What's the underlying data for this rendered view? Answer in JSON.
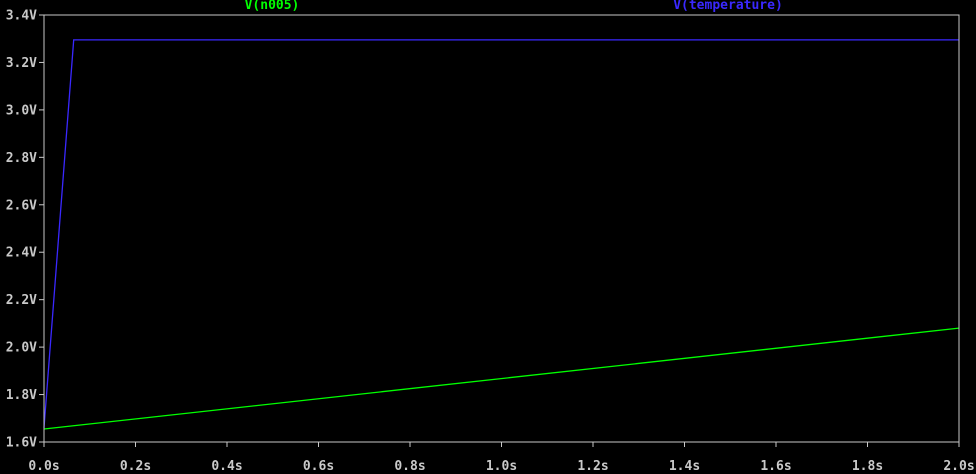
{
  "chart_data": {
    "type": "line",
    "title": "",
    "xlabel": "",
    "ylabel": "",
    "xlim": [
      0.0,
      2.0
    ],
    "ylim": [
      1.6,
      3.4
    ],
    "grid": false,
    "x_ticks": [
      0.0,
      0.2,
      0.4,
      0.6,
      0.8,
      1.0,
      1.2,
      1.4,
      1.6,
      1.8,
      2.0
    ],
    "x_tick_labels": [
      "0.0s",
      "0.2s",
      "0.4s",
      "0.6s",
      "0.8s",
      "1.0s",
      "1.2s",
      "1.4s",
      "1.6s",
      "1.8s",
      "2.0s"
    ],
    "y_ticks": [
      1.6,
      1.8,
      2.0,
      2.2,
      2.4,
      2.6,
      2.8,
      3.0,
      3.2,
      3.4
    ],
    "y_tick_labels": [
      "1.6V",
      "1.8V",
      "2.0V",
      "2.2V",
      "2.4V",
      "2.6V",
      "2.8V",
      "3.0V",
      "3.2V",
      "3.4V"
    ],
    "series": [
      {
        "name": "V(n005)",
        "color": "#00ff00",
        "x": [
          0.0,
          2.0
        ],
        "y": [
          1.655,
          2.08
        ]
      },
      {
        "name": "V(temperature)",
        "color": "#3a28ff",
        "x": [
          0.0,
          0.065,
          2.0
        ],
        "y": [
          1.66,
          3.295,
          3.295
        ]
      }
    ]
  },
  "colors": {
    "background": "#000000",
    "frame": "#c9c9c9",
    "tick_text": "#c9c9c9"
  }
}
